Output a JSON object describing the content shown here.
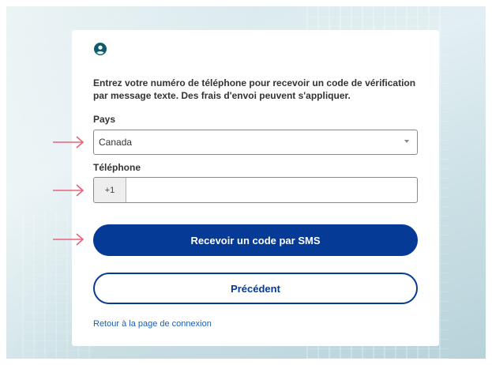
{
  "form": {
    "intro_text": "Entrez votre numéro de téléphone pour recevoir un code de vérification par message texte. Des frais d'envoi peuvent s'appliquer.",
    "country_label": "Pays",
    "country_value": "Canada",
    "phone_label": "Téléphone",
    "phone_prefix": "+1",
    "phone_value": "",
    "send_sms_label": "Recevoir un code par SMS",
    "previous_label": "Précédent",
    "back_to_login_label": "Retour à la page de connexion"
  },
  "icons": {
    "user": "user-circle-icon",
    "dropdown": "chevron-down-icon",
    "annotation_arrow": "arrow-right-icon"
  },
  "colors": {
    "primary": "#053a97",
    "link": "#1a5dbb",
    "annotation_arrow": "#e8637a"
  }
}
